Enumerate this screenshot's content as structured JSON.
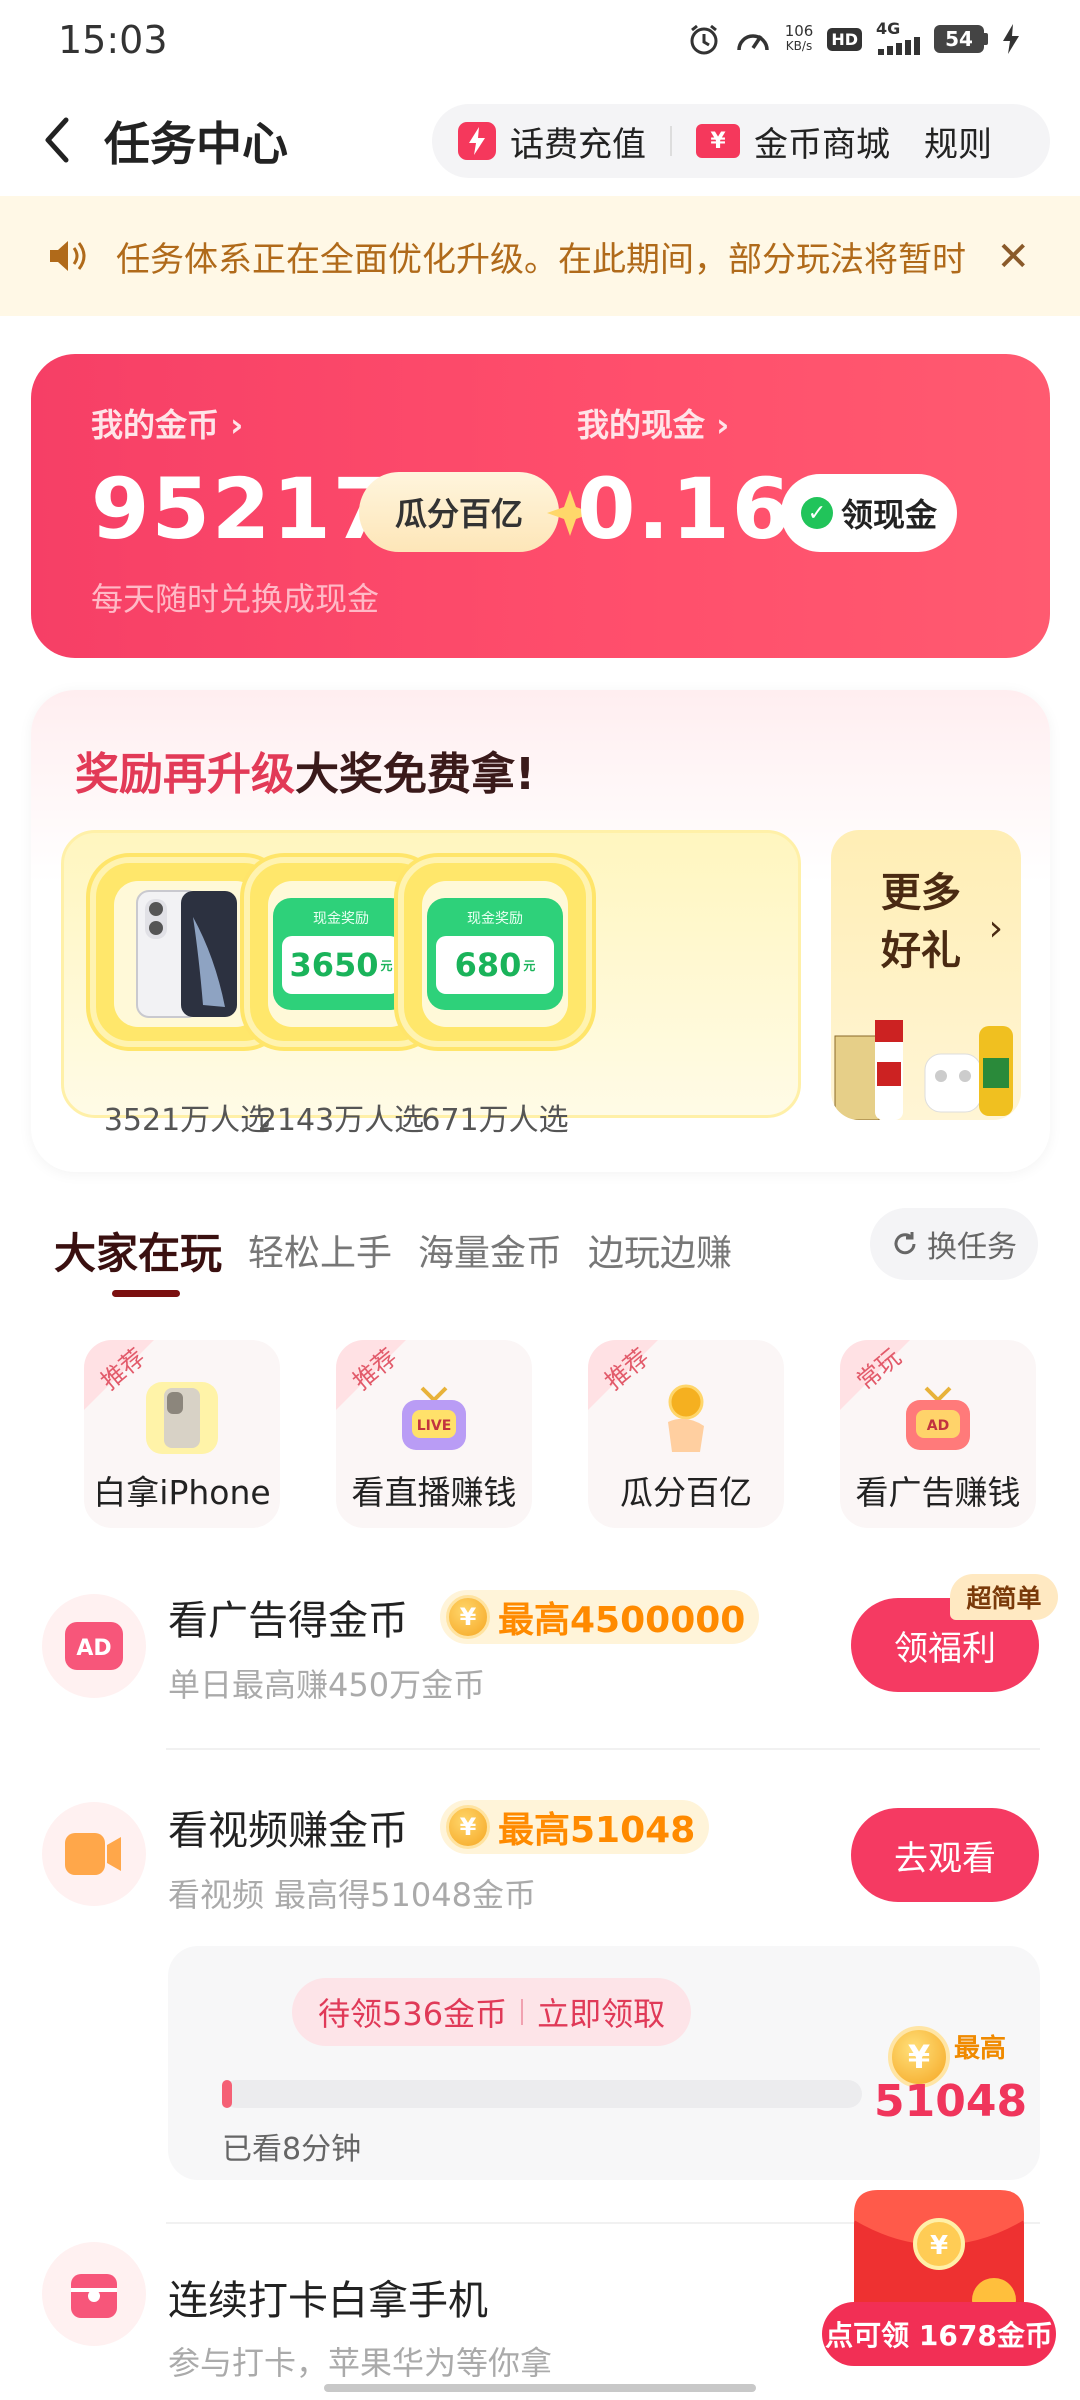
{
  "status": {
    "time": "15:03",
    "net_speed": "106",
    "net_unit": "KB/s",
    "hd": "HD",
    "signal": "4G",
    "battery": "54"
  },
  "header": {
    "title": "任务中心",
    "recharge_label": "话费充值",
    "mall_label": "金币商城",
    "mall_icon_text": "¥",
    "rules_label": "规则"
  },
  "notice": {
    "text": "任务体系正在全面优化升级。在此期间，部分玩法将暂时"
  },
  "wallet": {
    "coins_label": "我的金币 ›",
    "coins_value": "95217",
    "guafen_label": "瓜分百亿",
    "cash_label": "我的现金 ›",
    "cash_value": "0.16",
    "withdraw_label": "领现金",
    "exchange_hint": "每天随时兑换成现金"
  },
  "rewards": {
    "title_red": "奖励再升级",
    "title_dark": "大奖免费拿!",
    "items": [
      {
        "type": "phone",
        "count": "3521万人选"
      },
      {
        "type": "cash",
        "tag": "现金奖励",
        "amount": "3650",
        "unit": "元",
        "count": "2143万人选"
      },
      {
        "type": "cash",
        "tag": "现金奖励",
        "amount": "680",
        "unit": "元",
        "count": "671万人选"
      }
    ],
    "more_line1": "更多",
    "more_line2": "好礼",
    "more_chevron": "›"
  },
  "tabs": {
    "items": [
      "大家在玩",
      "轻松上手",
      "海量金币",
      "边玩边赚"
    ],
    "active": 0,
    "swap_label": "换任务"
  },
  "quick": [
    {
      "tag": "推荐",
      "label": "白拿iPhone"
    },
    {
      "tag": "推荐",
      "label": "看直播赚钱"
    },
    {
      "tag": "推荐",
      "label": "瓜分百亿"
    },
    {
      "tag": "常玩",
      "label": "看广告赚钱"
    }
  ],
  "tasks": [
    {
      "title": "看广告得金币",
      "badge": "最高4500000",
      "sub": "单日最高赚450万金币",
      "button": "领福利",
      "tag": "超简单"
    },
    {
      "title": "看视频赚金币",
      "badge": "最高51048",
      "sub": "看视频 最高得51048金币",
      "button": "去观看"
    },
    {
      "title": "连续打卡白拿手机",
      "sub": "参与打卡，苹果华为等你拿"
    }
  ],
  "video_progress": {
    "pending": "待领536金币",
    "claim": "立即领取",
    "watched": "已看8分钟",
    "max_label": "最高",
    "max_value": "51048",
    "fill_ratio": 0.015
  },
  "redpack": {
    "label": "点可领 1678金币"
  },
  "colors": {
    "primary": "#f53a62",
    "gold": "#ff8a00",
    "wallet_bg": "#f63f66"
  }
}
